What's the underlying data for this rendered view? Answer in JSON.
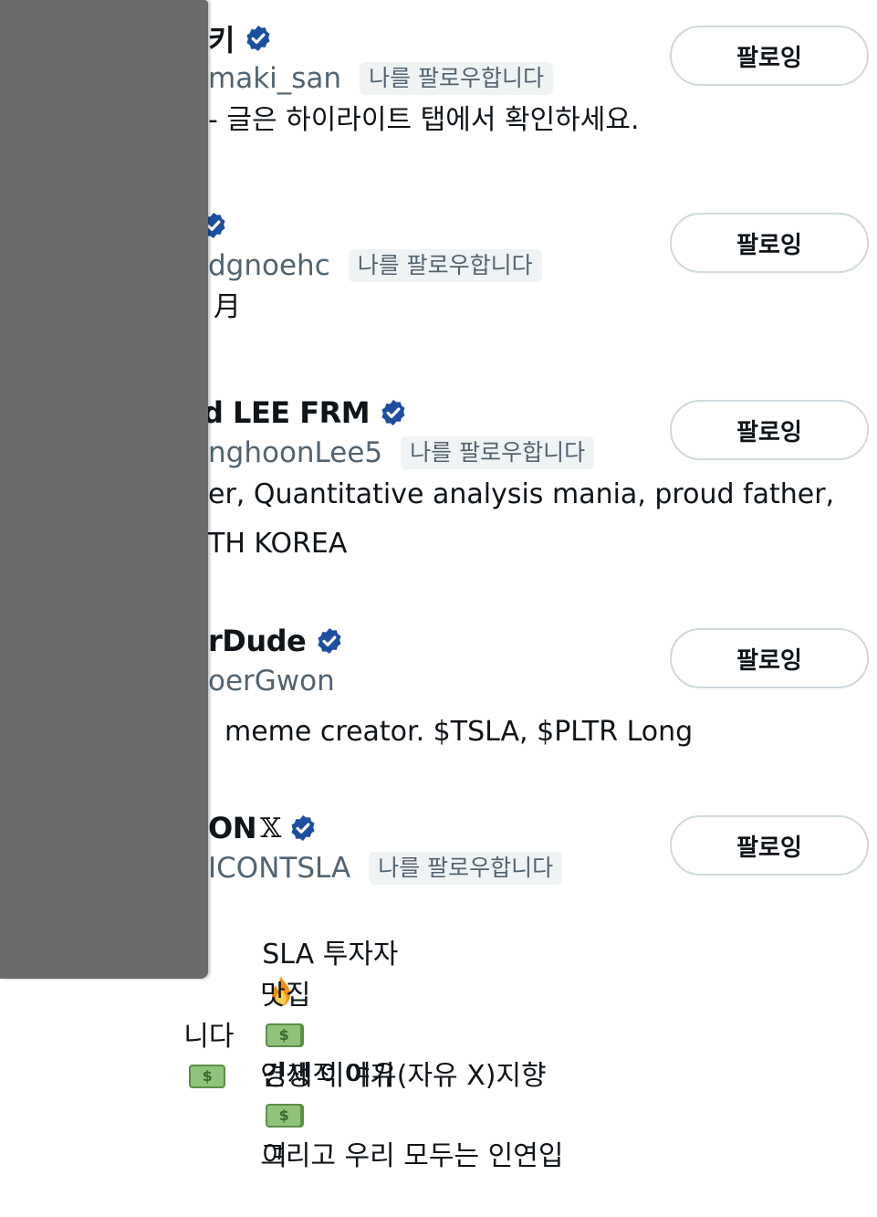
{
  "colors": {
    "verified_blue": "#1d4fa0",
    "handle_gray": "#536471",
    "badge_bg": "#eff3f4",
    "button_border": "#cfd9de",
    "overlay_gray": "#6a6b6d"
  },
  "accounts": [
    {
      "name": "키",
      "handle": "maki_san",
      "follows_you": "나를 팔로우합니다",
      "bio": "- 글은 하이라이트 탭에서 확인하세요.",
      "follow_button": "팔로잉",
      "verified_icon": "verified-badge-icon"
    },
    {
      "name": "",
      "handle": "dgnoehc",
      "follows_you": "나를 팔로우합니다",
      "bio": "月",
      "follow_button": "팔로잉",
      "verified_icon": "verified-badge-icon"
    },
    {
      "name": "d LEE FRM",
      "handle": "nghoonLee5",
      "follows_you": "나를 팔로우합니다",
      "bio_line1": "er, Quantitative analysis mania, proud father,",
      "bio_line2": "TH KOREA",
      "follow_button": "팔로잉",
      "verified_icon": "verified-badge-icon"
    },
    {
      "name": "rDude",
      "handle": "oerGwon",
      "bio": "meme creator. $TSLA, $PLTR Long",
      "follow_button": "팔로잉",
      "verified_icon": "verified-badge-icon"
    },
    {
      "name": "ON",
      "x_mark": "𝕏",
      "handle": "ICONTSLA",
      "follows_you": "나를 팔로우합니다",
      "bio_line1_a": "SLA 투자자",
      "bio_line1_b": "경제적 여유(자유 X)지향",
      "bio_line1_c": "여",
      "bio_line2_a": "맛집",
      "bio_line2_b": "인생 이야기",
      "bio_line2_c": "그리고 우리 모두는 인연입",
      "bio_line3": "니다",
      "follow_button": "팔로잉",
      "verified_icon": "verified-badge-icon"
    }
  ]
}
